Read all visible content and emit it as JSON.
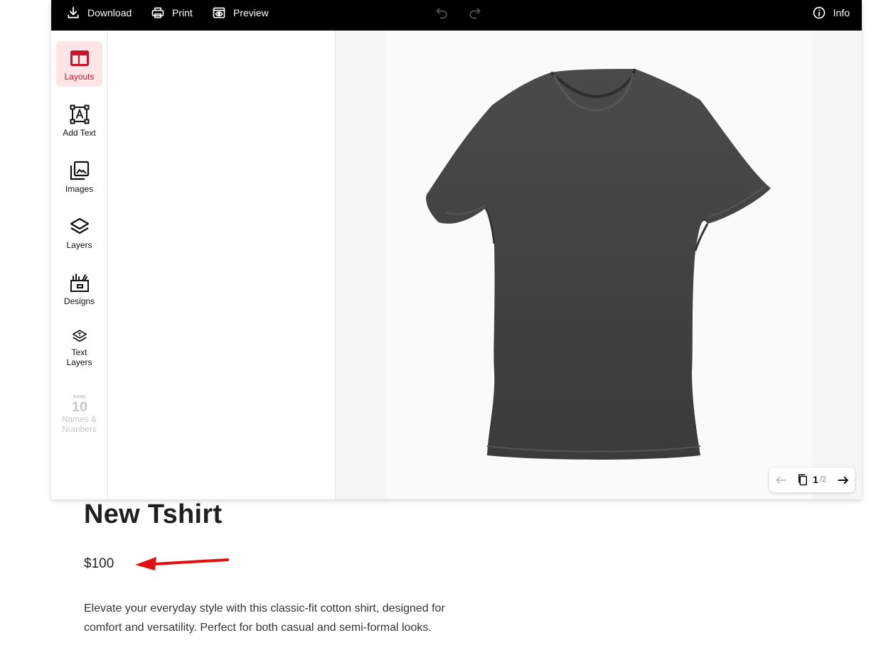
{
  "toolbar": {
    "download_label": "Download",
    "print_label": "Print",
    "preview_label": "Preview",
    "info_label": "Info",
    "icons": [
      "download-icon",
      "print-icon",
      "preview-icon",
      "undo-icon",
      "redo-icon",
      "info-icon"
    ]
  },
  "rail": {
    "items": [
      {
        "label": "Layouts",
        "icon": "layout-icon",
        "state": "active"
      },
      {
        "label": "Add Text",
        "icon": "add-text-icon"
      },
      {
        "label": "Images",
        "icon": "images-icon"
      },
      {
        "label": "Layers",
        "icon": "layers-icon"
      },
      {
        "label": "Designs",
        "icon": "designs-icon"
      },
      {
        "label": "Text\nLayers",
        "icon": "text-layers-icon"
      },
      {
        "label": "Names &\nNumbers",
        "icon": "names-numbers-icon",
        "state": "disabled"
      }
    ],
    "names_icon_text": {
      "top": "NAME",
      "number": "10"
    }
  },
  "pager": {
    "current": "1",
    "total": "/2"
  },
  "product": {
    "title": "New Tshirt",
    "price": "$100",
    "description": "Elevate your everyday style with this classic-fit cotton shirt, designed for comfort and versatility. Perfect for both casual and semi-formal looks."
  },
  "colors": {
    "topbar": "#000000",
    "accent": "#c4152b",
    "accent_bg": "#fde4e6",
    "shirt": "#464646",
    "annotation_arrow": "#e01010"
  }
}
